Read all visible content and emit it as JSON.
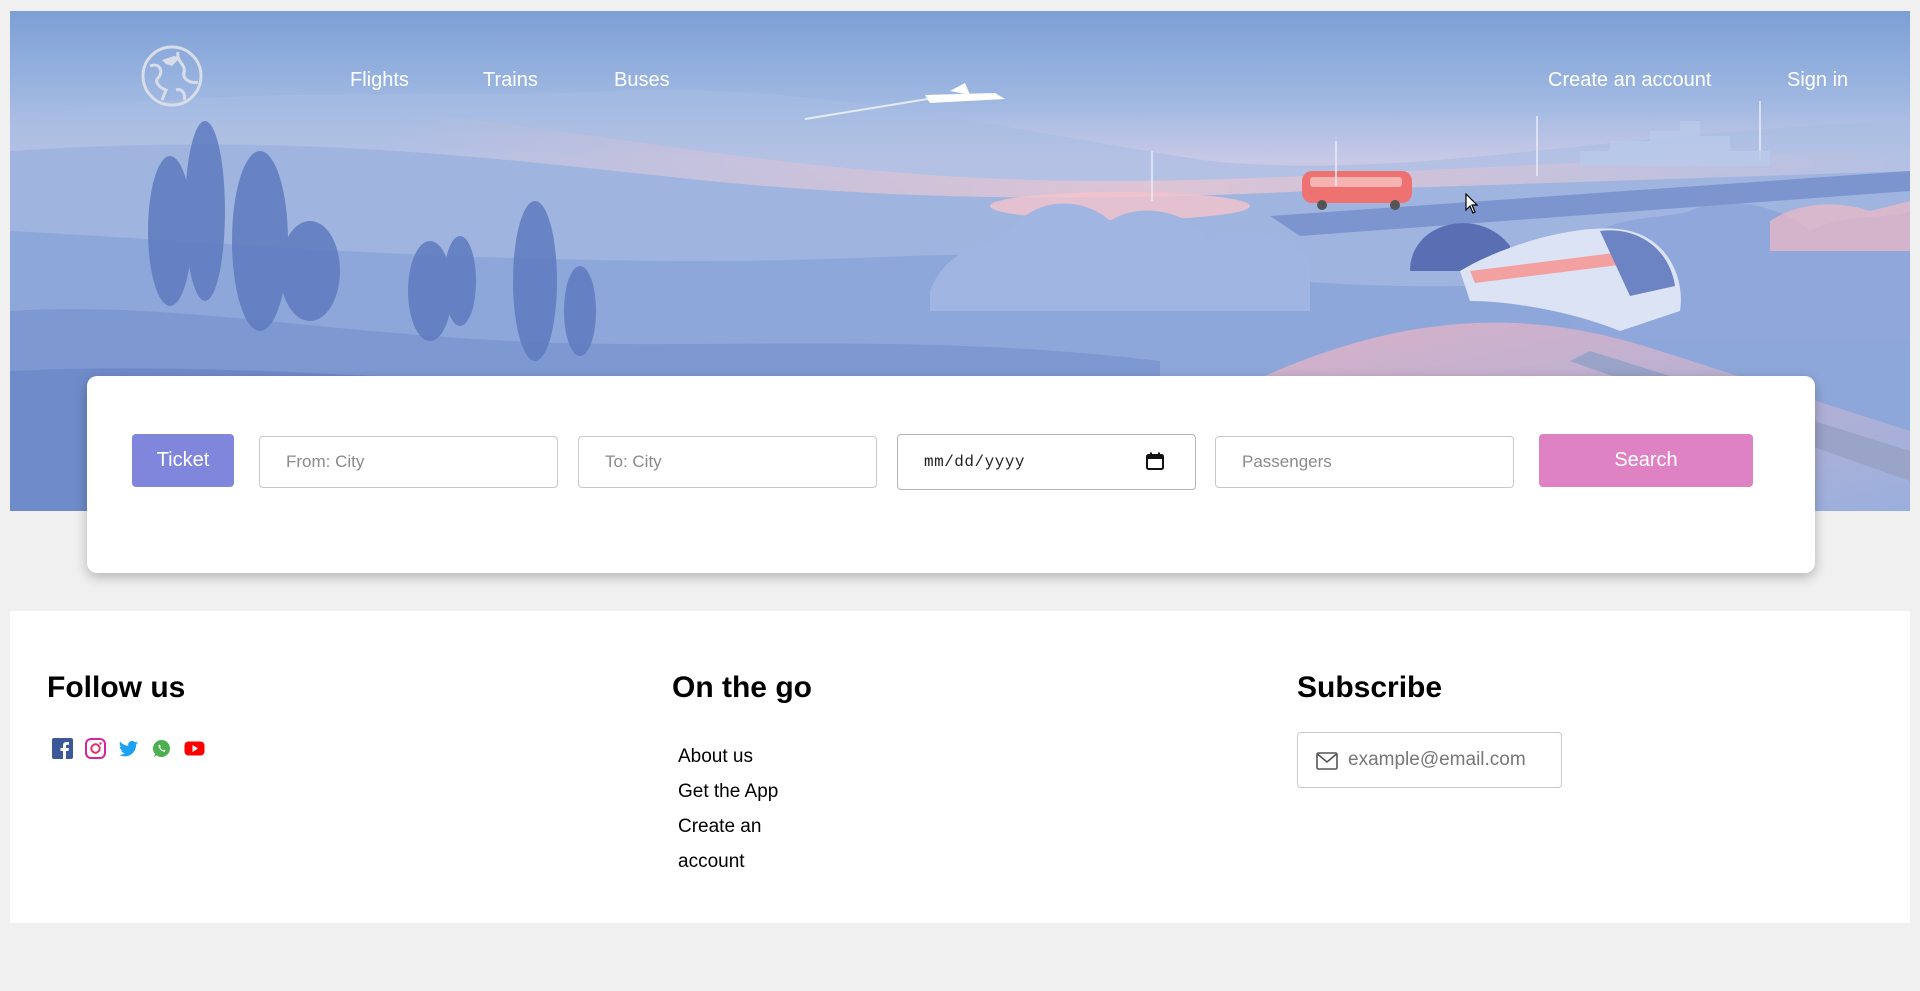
{
  "nav": {
    "logo_icon": "globe-airplane-icon",
    "links": [
      {
        "label": "Flights"
      },
      {
        "label": "Trains"
      },
      {
        "label": "Buses"
      }
    ],
    "create_account": "Create an account",
    "sign_in": "Sign in"
  },
  "search": {
    "ticket_label": "Ticket",
    "from_placeholder": "From: City",
    "to_placeholder": "To: City",
    "date_placeholder": "mm/dd/yyyy",
    "passengers_placeholder": "Passengers",
    "search_label": "Search"
  },
  "footer": {
    "follow": {
      "title": "Follow us",
      "icons": [
        "facebook-icon",
        "instagram-icon",
        "twitter-icon",
        "whatsapp-icon",
        "youtube-icon"
      ]
    },
    "onthego": {
      "title": "On the go",
      "links": [
        "About us",
        "Get the App",
        "Create an account"
      ]
    },
    "subscribe": {
      "title": "Subscribe",
      "email_placeholder": "example@email.com"
    }
  },
  "colors": {
    "ticket_button": "#7f86dc",
    "search_button": "#df82c4",
    "hero_sky": "#7d9fd6"
  }
}
